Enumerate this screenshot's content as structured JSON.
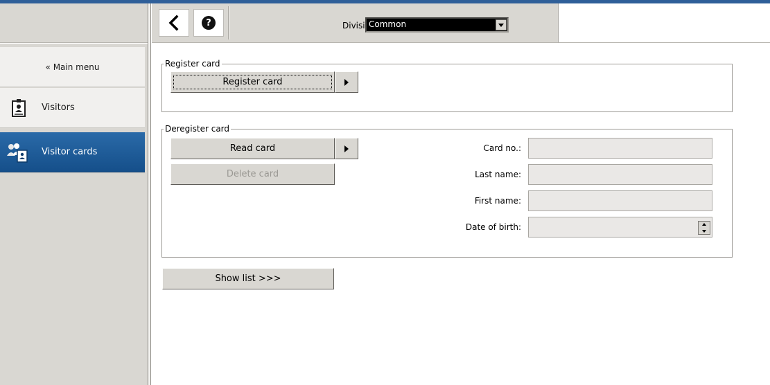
{
  "toolbar": {
    "back_icon": "chevron-left-icon",
    "help_icon": "help-icon",
    "help_glyph": "?",
    "division_label": "Division:",
    "division_value": "Common"
  },
  "sidebar": {
    "items": [
      {
        "label": "« Main menu",
        "selected": false
      },
      {
        "label": "Visitors",
        "icon": "visitor-badge-icon",
        "selected": false
      },
      {
        "label": "Visitor cards",
        "icon": "visitor-cards-icon",
        "selected": true
      }
    ],
    "selected_color": "#1b5a97"
  },
  "register": {
    "legend": "Register card",
    "register_button": "Register card"
  },
  "deregister": {
    "legend": "Deregister card",
    "read_button": "Read card",
    "delete_button": "Delete card",
    "fields": [
      {
        "label": "Card no.:",
        "value": ""
      },
      {
        "label": "Last name:",
        "value": ""
      },
      {
        "label": "First name:",
        "value": ""
      },
      {
        "label": "Date of birth:",
        "value": ""
      }
    ]
  },
  "show_list_button": "Show list >>>"
}
